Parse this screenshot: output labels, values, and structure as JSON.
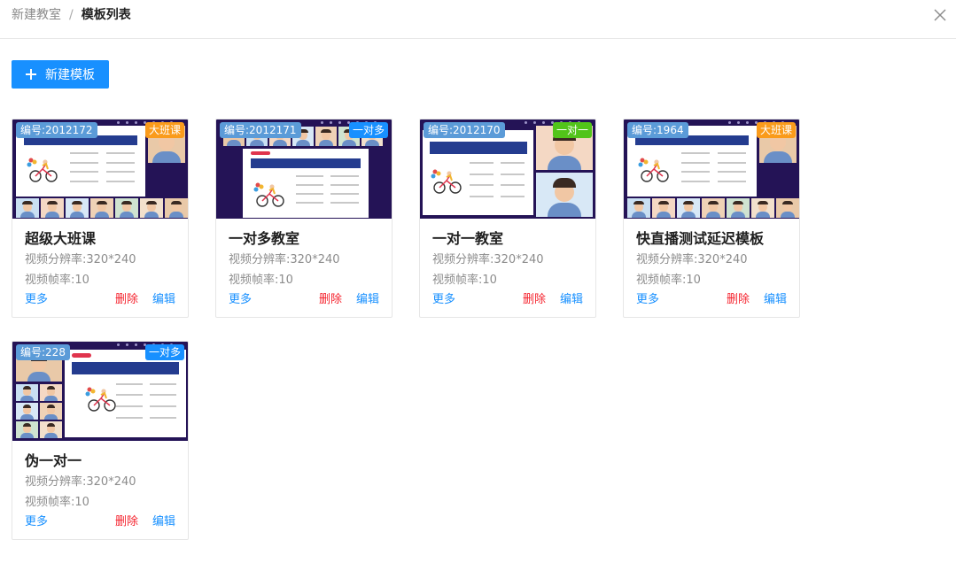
{
  "header": {
    "breadcrumb_parent": "新建教室",
    "breadcrumb_separator": "/",
    "breadcrumb_current": "模板列表"
  },
  "toolbar": {
    "new_label": "新建模板"
  },
  "colors": {
    "primary": "#1890ff",
    "danger": "#f5222d",
    "badge_id": "#5b9bd8",
    "badge_orange": "#fa9b1b",
    "badge_blue": "#1890ff",
    "badge_green": "#52c41a",
    "thumb_bg": "#241356"
  },
  "cards": [
    {
      "id_label": "编号:2012172",
      "type_label": "大班课",
      "type_color": "#fa9b1b",
      "layout": "large",
      "name": "超级大班课",
      "resolution": "视频分辨率:320*240",
      "framerate": "视频帧率:10",
      "more": "更多",
      "delete": "删除",
      "edit": "编辑"
    },
    {
      "id_label": "编号:2012171",
      "type_label": "一对多",
      "type_color": "#1890ff",
      "layout": "top-row",
      "name": "一对多教室",
      "resolution": "视频分辨率:320*240",
      "framerate": "视频帧率:10",
      "more": "更多",
      "delete": "删除",
      "edit": "编辑"
    },
    {
      "id_label": "编号:2012170",
      "type_label": "一对一",
      "type_color": "#52c41a",
      "layout": "one-on-one",
      "name": "一对一教室",
      "resolution": "视频分辨率:320*240",
      "framerate": "视频帧率:10",
      "more": "更多",
      "delete": "删除",
      "edit": "编辑"
    },
    {
      "id_label": "编号:1964",
      "type_label": "大班课",
      "type_color": "#fa9b1b",
      "layout": "large",
      "name": "快直播测试延迟模板",
      "resolution": "视频分辨率:320*240",
      "framerate": "视频帧率:10",
      "more": "更多",
      "delete": "删除",
      "edit": "编辑"
    },
    {
      "id_label": "编号:228",
      "type_label": "一对多",
      "type_color": "#1890ff",
      "layout": "left-grid",
      "name": "伪一对一",
      "resolution": "视频分辨率:320*240",
      "framerate": "视频帧率:10",
      "more": "更多",
      "delete": "删除",
      "edit": "编辑"
    }
  ]
}
